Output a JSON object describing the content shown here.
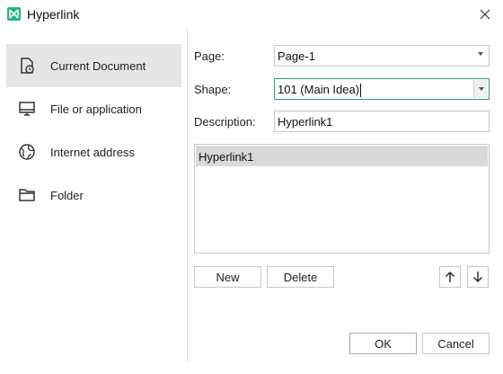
{
  "window": {
    "title": "Hyperlink",
    "close_icon": "close-icon",
    "accent_color": "#20b97a"
  },
  "sidebar": {
    "items": [
      {
        "label": "Current Document",
        "icon": "document-clock-icon",
        "active": true
      },
      {
        "label": "File or application",
        "icon": "monitor-icon",
        "active": false
      },
      {
        "label": "Internet address",
        "icon": "globe-icon",
        "active": false
      },
      {
        "label": "Folder",
        "icon": "folder-icon",
        "active": false
      }
    ]
  },
  "form": {
    "page_label": "Page:",
    "page_value": "Page-1",
    "shape_label": "Shape:",
    "shape_value": "101 (Main Idea)",
    "description_label": "Description:",
    "description_value": "Hyperlink1"
  },
  "list": {
    "items": [
      "Hyperlink1"
    ]
  },
  "buttons": {
    "new": "New",
    "delete": "Delete",
    "ok": "OK",
    "cancel": "Cancel",
    "move_up_icon": "arrow-up-icon",
    "move_down_icon": "arrow-down-icon"
  }
}
